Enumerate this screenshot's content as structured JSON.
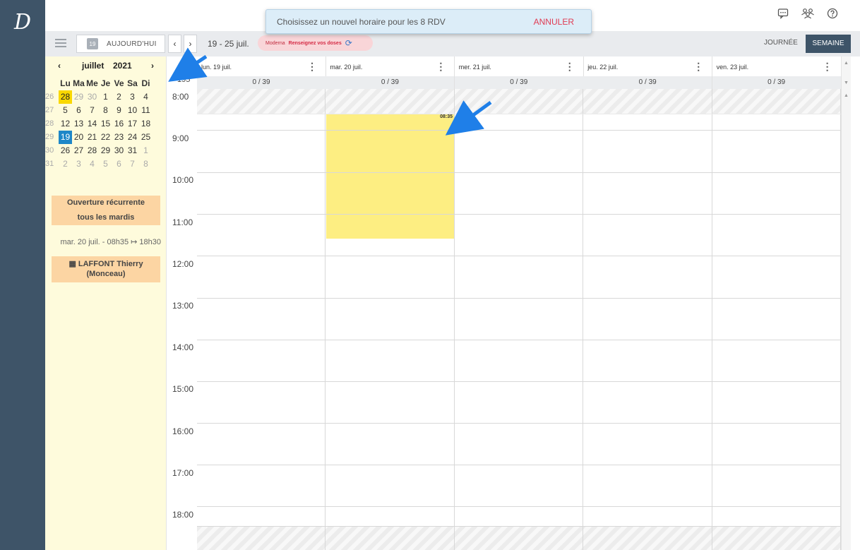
{
  "app": {
    "logo": "D"
  },
  "banner": {
    "message": "Choisissez un nouvel horaire pour les 8 RDV",
    "cancel_label": "ANNULER"
  },
  "top_icons": {
    "chat": "chat-icon",
    "users": "users-icon",
    "help": "help-icon"
  },
  "toolbar": {
    "today_icon_day": "19",
    "today_label": "AUJOURD'HUI",
    "prev": "‹",
    "next": "›",
    "date_range": "19 - 25 juil.",
    "vaccine_name": "Moderna",
    "vaccine_action": "Renseignez vos doses",
    "refresh_icon": "⟳",
    "view_day": "JOURNÉE",
    "view_week": "SEMAINE"
  },
  "mini_calendar": {
    "prev": "‹",
    "month": "juillet",
    "year": "2021",
    "next": "›",
    "weekday_headers": [
      "Lu",
      "Ma",
      "Me",
      "Je",
      "Ve",
      "Sa",
      "Di"
    ],
    "weeks": [
      {
        "wk": "26",
        "days": [
          "28",
          "29",
          "30",
          "1",
          "2",
          "3",
          "4"
        ]
      },
      {
        "wk": "27",
        "days": [
          "5",
          "6",
          "7",
          "8",
          "9",
          "10",
          "11"
        ]
      },
      {
        "wk": "28",
        "days": [
          "12",
          "13",
          "14",
          "15",
          "16",
          "17",
          "18"
        ]
      },
      {
        "wk": "29",
        "days": [
          "19",
          "20",
          "21",
          "22",
          "23",
          "24",
          "25"
        ]
      },
      {
        "wk": "30",
        "days": [
          "26",
          "27",
          "28",
          "29",
          "30",
          "31",
          "1"
        ]
      },
      {
        "wk": "31",
        "days": [
          "2",
          "3",
          "4",
          "5",
          "6",
          "7",
          "8"
        ]
      }
    ]
  },
  "sidebar": {
    "recurring_line1": "Ouverture récurrente",
    "recurring_line2": "tous les mardis",
    "slot_info": "mar. 20 juil. - 08h35 ↦ 18h30",
    "practitioner_line1": "LAFFONT Thierry",
    "practitioner_line2": "(Monceau)",
    "practitioner_icon": "calendar-icon"
  },
  "time_column": {
    "head_top": "0",
    "head_bottom": "195",
    "hours": [
      "8:00",
      "9:00",
      "10:00",
      "11:00",
      "12:00",
      "13:00",
      "14:00",
      "15:00",
      "16:00",
      "17:00",
      "18:00"
    ]
  },
  "days": [
    {
      "title": "lun. 19 juil.",
      "count": "0 / 39"
    },
    {
      "title": "mar. 20 juil.",
      "count": "0 / 39"
    },
    {
      "title": "mer. 21 juil.",
      "count": "0 / 39"
    },
    {
      "title": "jeu. 22 juil.",
      "count": "0 / 39"
    },
    {
      "title": "ven. 23 juil.",
      "count": "0 / 39"
    }
  ],
  "appointment": {
    "start_label": "08:35"
  },
  "colors": {
    "sidebar_dark": "#3e5468",
    "highlight_yellow": "#fdee82",
    "selected_day": "#f9d800",
    "current_day": "#1e87c8",
    "card_orange": "#fcd5a3",
    "cancel_red": "#e03a52",
    "annotation_arrow": "#1f7fe8"
  }
}
